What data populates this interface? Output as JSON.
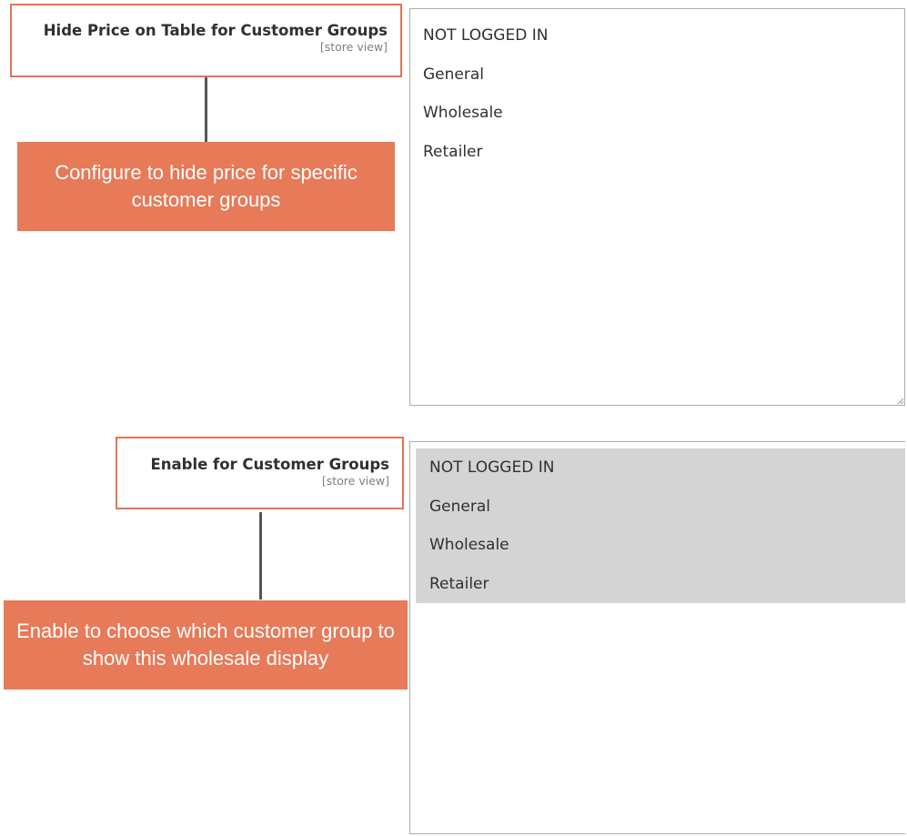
{
  "section1": {
    "label": "Hide Price on Table for Customer Groups",
    "scope": "[store view]",
    "callout": "Configure to hide price for specific customer groups",
    "options": [
      "NOT LOGGED IN",
      "General",
      "Wholesale",
      "Retailer"
    ]
  },
  "section2": {
    "label": "Enable for Customer Groups",
    "scope": "[store view]",
    "callout": "Enable to choose which customer group to show this wholesale display",
    "options": [
      "NOT LOGGED IN",
      "General",
      "Wholesale",
      "Retailer"
    ],
    "selected": [
      "NOT LOGGED IN",
      "General",
      "Wholesale",
      "Retailer"
    ]
  },
  "colors": {
    "accent": "#e77a59",
    "outline": "#e5734f",
    "selected_bg": "#d4d4d4"
  }
}
